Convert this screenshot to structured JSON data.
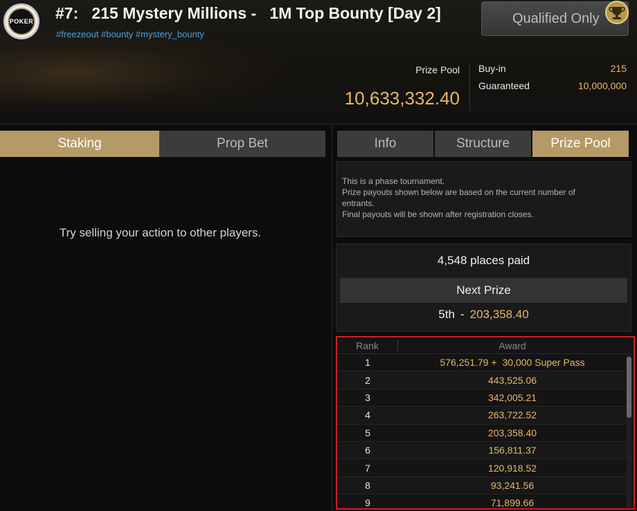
{
  "header": {
    "logo_text": "POKER",
    "title": "#7:   215 Mystery Millions -   1M Top Bounty [Day 2]",
    "tags": "#freezeout #bounty #mystery_bounty",
    "qualified_label": "Qualified Only",
    "prize_pool_label": "Prize Pool",
    "prize_pool_value": "10,633,332.40",
    "buyin_label": "Buy-in",
    "buyin_value": "215",
    "guaranteed_label": "Guaranteed",
    "guaranteed_value": "10,000,000"
  },
  "left": {
    "tabs": [
      {
        "label": "Staking"
      },
      {
        "label": "Prop Bet"
      }
    ],
    "message": "Try selling your action to other players."
  },
  "right": {
    "tabs": [
      {
        "label": "Info"
      },
      {
        "label": "Structure"
      },
      {
        "label": "Prize Pool"
      }
    ],
    "notice": [
      "This is a phase tournament.",
      "Prize payouts shown below are based on the current number of",
      "entrants.",
      "Final payouts will be shown after registration closes."
    ],
    "places_paid": "4,548 places paid",
    "next_prize_label": "Next Prize",
    "next_prize_place": "5th",
    "next_prize_dash": "-",
    "next_prize_amount": "203,358.40"
  },
  "payouts": {
    "headers": {
      "rank": "Rank",
      "award": "Award"
    },
    "rows": [
      {
        "rank": "1",
        "award": "576,251.79 +",
        "extra": "30,000 Super Pass"
      },
      {
        "rank": "2",
        "award": "443,525.06"
      },
      {
        "rank": "3",
        "award": "342,005.21"
      },
      {
        "rank": "4",
        "award": "263,722.52"
      },
      {
        "rank": "5",
        "award": "203,358.40"
      },
      {
        "rank": "6",
        "award": "156,811.37"
      },
      {
        "rank": "7",
        "award": "120,918.52"
      },
      {
        "rank": "8",
        "award": "93,241.56"
      },
      {
        "rank": "9",
        "award": "71,899.66"
      }
    ]
  },
  "colors": {
    "accent_gold": "#b59a67",
    "value_gold": "#e8b866",
    "link_blue": "#4a9fe0",
    "highlight_red": "#d11f1f"
  }
}
